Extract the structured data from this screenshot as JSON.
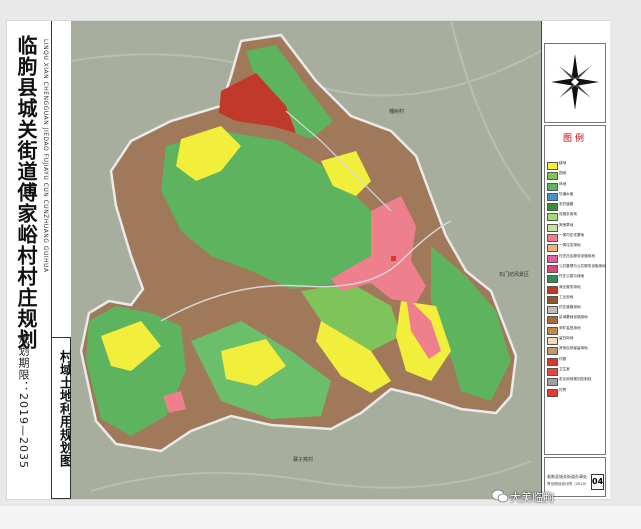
{
  "title": "临朐县城关街道傅家峪村村庄规划",
  "title_pinyin": "LINQU XIAN CHENGGUAN JIEDAO FUJIAYU CUN CUNZHUANG GUIHUA",
  "period": "规划期限：2019—2035",
  "subtitle": "村域土地利用规划图",
  "map_labels": {
    "north_village": "槐树村",
    "east_village": "石门坊风景区",
    "south_village": "寨子窝村"
  },
  "legend": {
    "title": "图例",
    "items": [
      {
        "label": "耕地",
        "color": "#f2ee3c"
      },
      {
        "label": "园地",
        "color": "#7ec45a"
      },
      {
        "label": "林地",
        "color": "#5db35e"
      },
      {
        "label": "坑塘水面",
        "color": "#4a8fcf"
      },
      {
        "label": "农村道路",
        "color": "#3c8c3c"
      },
      {
        "label": "设施农用地",
        "color": "#a6d87a"
      },
      {
        "label": "其他草地",
        "color": "#c9e29e"
      },
      {
        "label": "一类村庄宅基地",
        "color": "#ee7f8d"
      },
      {
        "label": "一类住宅用地",
        "color": "#f5b07a"
      },
      {
        "label": "村庄社区服务设施用地",
        "color": "#e060a0"
      },
      {
        "label": "公共管理与公共服务设施用地",
        "color": "#d14a7a"
      },
      {
        "label": "村庄公园与绿地",
        "color": "#2f8f4f"
      },
      {
        "label": "商业服务用地",
        "color": "#c0392b"
      },
      {
        "label": "工业用地",
        "color": "#8b5a2b"
      },
      {
        "label": "村庄道路用地",
        "color": "#bdbdbd"
      },
      {
        "label": "区域基础设施用地",
        "color": "#a86b3c"
      },
      {
        "label": "采矿盐田用地",
        "color": "#c1884e"
      },
      {
        "label": "留白用地",
        "color": "#f0d9b5"
      },
      {
        "label": "其他自然保留用地",
        "color": "#c19a6b"
      },
      {
        "label": "村委",
        "color": "#d63a2f"
      },
      {
        "label": "卫生室",
        "color": "#e8473f"
      },
      {
        "label": "农业用地规划控制线",
        "color": "#9aa0a6"
      },
      {
        "label": "村界",
        "color": "#e53935"
      }
    ]
  },
  "footer": {
    "line1": "临朐县城关街道办事处",
    "line2": "青岛规划设计院（2019）",
    "sheet_no": "04"
  },
  "watermark": "大美临朐",
  "colors": {
    "farmland": "#f2ee3c",
    "forest": "#5db35e",
    "garden": "#7ec45a",
    "other": "#a0795a",
    "residential": "#ee7f8d",
    "commercial": "#c0392b",
    "boundary": "#e0e0e0",
    "outside": "#a7ae9e"
  }
}
